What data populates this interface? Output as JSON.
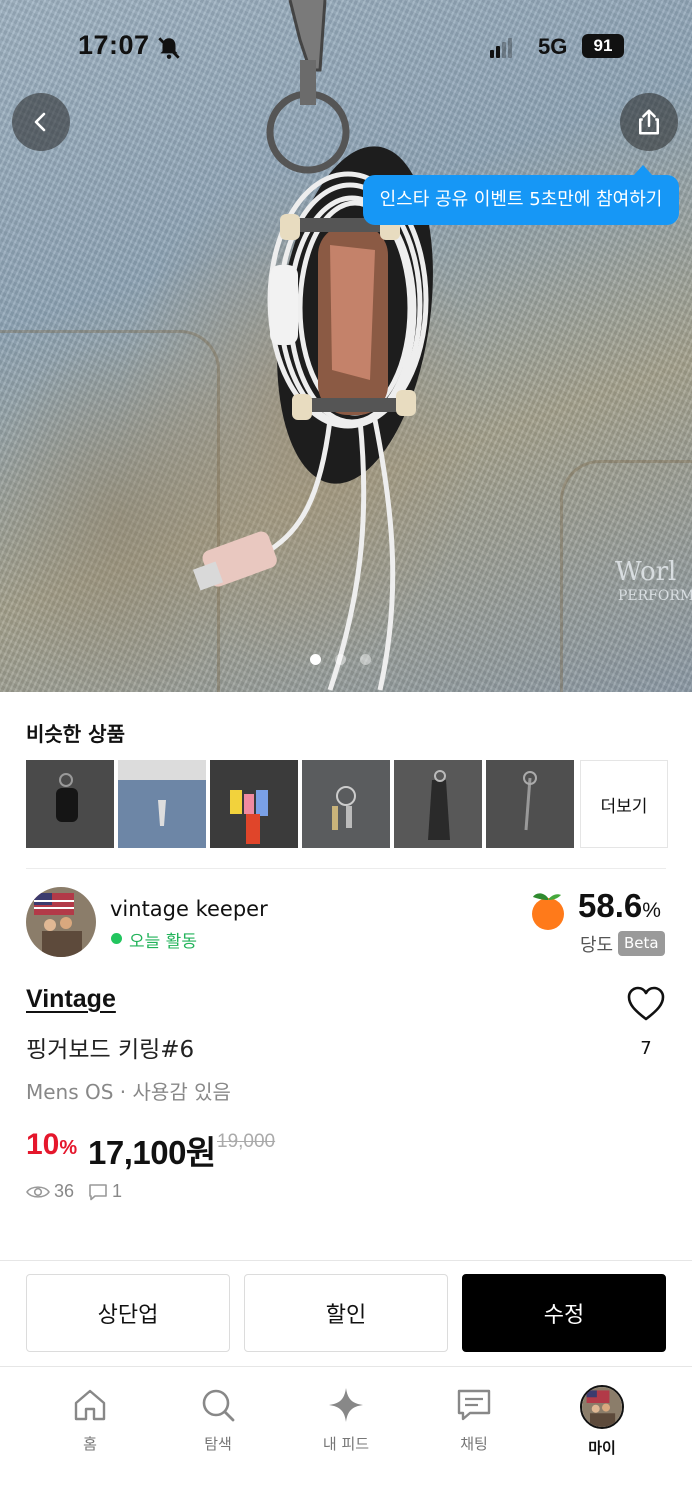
{
  "status_bar": {
    "time": "17:07",
    "network": "5G",
    "battery": "91"
  },
  "promo": {
    "text": "인스타 공유 이벤트 5초만에 참여하기"
  },
  "gallery": {
    "count": 3,
    "active": 1
  },
  "similar": {
    "title": "비슷한 상품",
    "more_label": "더보기",
    "item_count": 6
  },
  "seller": {
    "name": "vintage keeper",
    "activity": "오늘 활동",
    "score_value": "58.6",
    "score_unit": "%",
    "score_label": "당도",
    "beta_label": "Beta"
  },
  "product": {
    "brand": "Vintage",
    "title": "핑거보드 키링#6",
    "meta": "Mens OS · 사용감 있음",
    "discount_value": "10",
    "discount_unit": "%",
    "price": "17,100원",
    "original_price": "19,000",
    "likes": "7",
    "views": "36",
    "comments": "1"
  },
  "actions": {
    "bump": "상단업",
    "discount": "할인",
    "edit": "수정"
  },
  "tabs": [
    {
      "label": "홈",
      "icon": "home-icon"
    },
    {
      "label": "탐색",
      "icon": "search-icon"
    },
    {
      "label": "내 피드",
      "icon": "sparkle-icon"
    },
    {
      "label": "채팅",
      "icon": "chat-icon"
    },
    {
      "label": "마이",
      "icon": "avatar"
    }
  ],
  "colors": {
    "promo": "#1697f6",
    "discount": "#e5172c",
    "active_green": "#22c55e",
    "edit_button": "#000000"
  }
}
